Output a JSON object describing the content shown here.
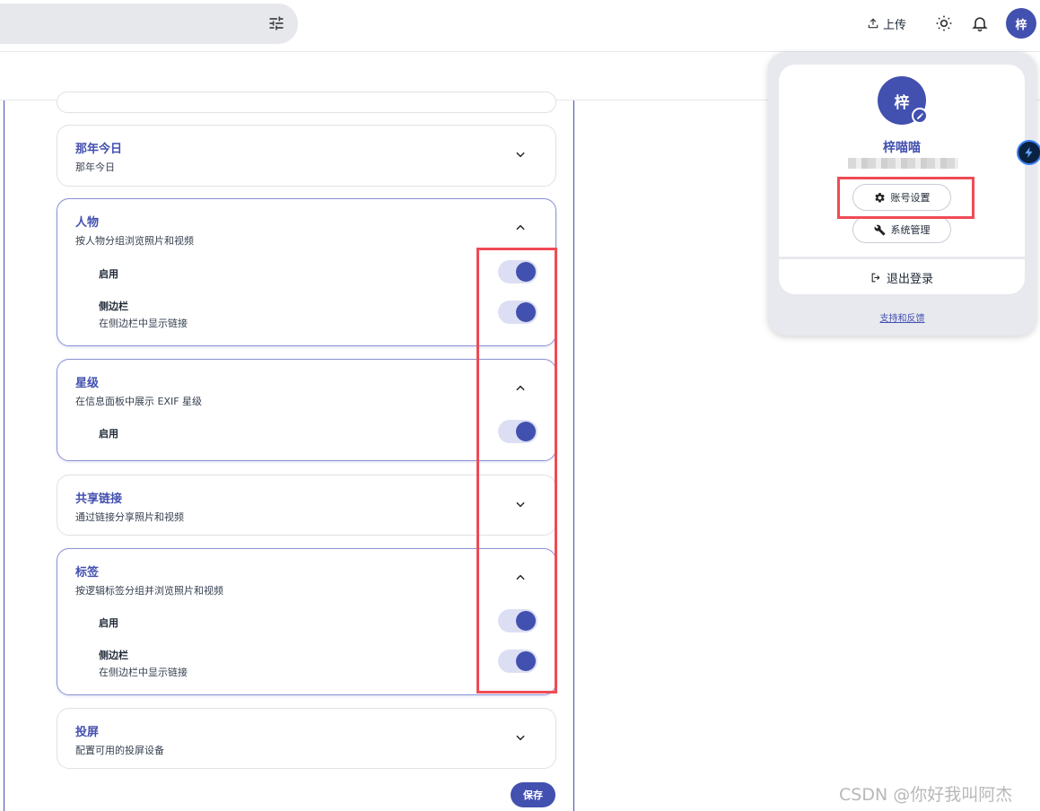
{
  "topbar": {
    "upload_label": "上传",
    "avatar_initial": "梓",
    "icons": [
      "tune-icon",
      "upload-icon",
      "sun-icon",
      "bell-icon"
    ]
  },
  "sections": {
    "memories": {
      "title": "那年今日",
      "desc": "那年今日"
    },
    "people": {
      "title": "人物",
      "desc": "按人物分组浏览照片和视频",
      "enable_label": "启用",
      "enabled": true,
      "sidebar_label": "侧边栏",
      "sidebar_desc": "在侧边栏中显示链接",
      "sidebar": true
    },
    "rating": {
      "title": "星级",
      "desc": "在信息面板中展示 EXIF 星级",
      "enable_label": "启用",
      "enabled": true
    },
    "shared_links": {
      "title": "共享链接",
      "desc": "通过链接分享照片和视频"
    },
    "tags": {
      "title": "标签",
      "desc": "按逻辑标签分组并浏览照片和视频",
      "enable_label": "启用",
      "enabled": true,
      "sidebar_label": "侧边栏",
      "sidebar_desc": "在侧边栏中显示链接",
      "sidebar": true
    },
    "cast": {
      "title": "投屏",
      "desc": "配置可用的投屏设备"
    }
  },
  "save_label": "保存",
  "account_menu": {
    "avatar_initial": "梓",
    "name": "梓喵喵",
    "account_settings_label": "账号设置",
    "admin_label": "系统管理",
    "logout_label": "退出登录",
    "support_label": "支持和反馈"
  },
  "watermark": "CSDN @你好我叫阿杰",
  "colors": {
    "primary": "#4250af",
    "toggle_track": "#dcdff3",
    "highlight": "#ef4b55"
  }
}
